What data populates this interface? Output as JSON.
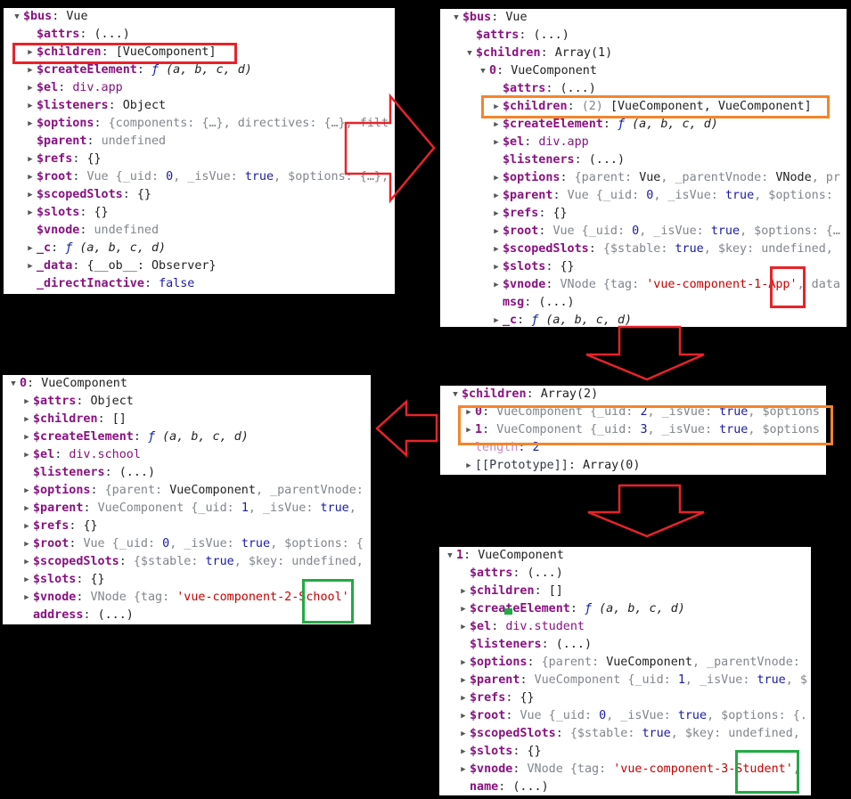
{
  "colors": {
    "arrow": "#e8222a",
    "red_box": "#e8222a",
    "orange_box": "#f5842a",
    "green_box": "#22aa44"
  },
  "panels": [
    {
      "id": "bus-root",
      "rows": [
        {
          "level": 0,
          "arrow": "expanded",
          "key": "$bus",
          "value": [
            [
              "t",
              "Vue"
            ]
          ]
        },
        {
          "level": 1,
          "arrow": "none",
          "key": "$attrs",
          "value": [
            [
              "t",
              "(...)"
            ]
          ]
        },
        {
          "level": 1,
          "arrow": "collapsed",
          "key": "$children",
          "value": [
            [
              "t",
              "[VueComponent]"
            ]
          ]
        },
        {
          "level": 1,
          "arrow": "collapsed",
          "key": "$createElement",
          "value": [
            [
              "f",
              "ƒ "
            ],
            [
              "i",
              "(a, b, c, d)"
            ]
          ]
        },
        {
          "level": 1,
          "arrow": "collapsed",
          "key": "$el",
          "value": [
            [
              "e",
              "div.app"
            ]
          ]
        },
        {
          "level": 1,
          "arrow": "collapsed",
          "key": "$listeners",
          "value": [
            [
              "t",
              "Object"
            ]
          ]
        },
        {
          "level": 1,
          "arrow": "collapsed",
          "key": "$options",
          "value": [
            [
              "g",
              "{components: {…}, directives: {…}, filt"
            ]
          ]
        },
        {
          "level": 1,
          "arrow": "none",
          "key": "$parent",
          "value": [
            [
              "g",
              "undefined"
            ]
          ]
        },
        {
          "level": 1,
          "arrow": "collapsed",
          "key": "$refs",
          "value": [
            [
              "t",
              "{}"
            ]
          ]
        },
        {
          "level": 1,
          "arrow": "collapsed",
          "key": "$root",
          "value": [
            [
              "g",
              "Vue {_uid: "
            ],
            [
              "n",
              "0"
            ],
            [
              "g",
              ", _isVue: "
            ],
            [
              "n",
              "true"
            ],
            [
              "g",
              ", $options: {…},"
            ]
          ]
        },
        {
          "level": 1,
          "arrow": "collapsed",
          "key": "$scopedSlots",
          "value": [
            [
              "t",
              "{}"
            ]
          ]
        },
        {
          "level": 1,
          "arrow": "collapsed",
          "key": "$slots",
          "value": [
            [
              "t",
              "{}"
            ]
          ]
        },
        {
          "level": 1,
          "arrow": "none",
          "key": "$vnode",
          "value": [
            [
              "g",
              "undefined"
            ]
          ]
        },
        {
          "level": 1,
          "arrow": "collapsed",
          "key": "_c",
          "value": [
            [
              "f",
              "ƒ "
            ],
            [
              "i",
              "(a, b, c, d)"
            ]
          ]
        },
        {
          "level": 1,
          "arrow": "collapsed",
          "key": "_data",
          "value": [
            [
              "t",
              "{__ob__: Observer}"
            ]
          ]
        },
        {
          "level": 1,
          "arrow": "none",
          "key": "_directInactive",
          "value": [
            [
              "n",
              "false"
            ]
          ]
        }
      ]
    },
    {
      "id": "bus-children-expanded",
      "rows": [
        {
          "level": 0,
          "arrow": "expanded",
          "key": "$bus",
          "value": [
            [
              "t",
              "Vue"
            ]
          ]
        },
        {
          "level": 1,
          "arrow": "none",
          "key": "$attrs",
          "value": [
            [
              "t",
              "(...)"
            ]
          ]
        },
        {
          "level": 1,
          "arrow": "expanded",
          "key": "$children",
          "value": [
            [
              "t",
              "Array(1)"
            ]
          ]
        },
        {
          "level": 2,
          "arrow": "expanded",
          "key": "0",
          "value": [
            [
              "t",
              "VueComponent"
            ]
          ]
        },
        {
          "level": 3,
          "arrow": "none",
          "key": "$attrs",
          "value": [
            [
              "t",
              "(...)"
            ]
          ]
        },
        {
          "level": 3,
          "arrow": "collapsed",
          "key": "$children",
          "value": [
            [
              "g",
              "(2) "
            ],
            [
              "t",
              "[VueComponent, VueComponent]"
            ]
          ]
        },
        {
          "level": 3,
          "arrow": "collapsed",
          "key": "$createElement",
          "value": [
            [
              "f",
              "ƒ "
            ],
            [
              "i",
              "(a, b, c, d)"
            ]
          ]
        },
        {
          "level": 3,
          "arrow": "collapsed",
          "key": "$el",
          "value": [
            [
              "e",
              "div.app"
            ]
          ]
        },
        {
          "level": 3,
          "arrow": "none",
          "key": "$listeners",
          "value": [
            [
              "t",
              "(...)"
            ]
          ]
        },
        {
          "level": 3,
          "arrow": "collapsed",
          "key": "$options",
          "value": [
            [
              "g",
              "{parent: "
            ],
            [
              "t",
              "Vue"
            ],
            [
              "g",
              ", _parentVnode: "
            ],
            [
              "t",
              "VNode"
            ],
            [
              "g",
              ", pr"
            ]
          ]
        },
        {
          "level": 3,
          "arrow": "collapsed",
          "key": "$parent",
          "value": [
            [
              "g",
              "Vue {_uid: "
            ],
            [
              "n",
              "0"
            ],
            [
              "g",
              ", _isVue: "
            ],
            [
              "n",
              "true"
            ],
            [
              "g",
              ", $options:"
            ]
          ]
        },
        {
          "level": 3,
          "arrow": "collapsed",
          "key": "$refs",
          "value": [
            [
              "t",
              "{}"
            ]
          ]
        },
        {
          "level": 3,
          "arrow": "collapsed",
          "key": "$root",
          "value": [
            [
              "g",
              "Vue {_uid: "
            ],
            [
              "n",
              "0"
            ],
            [
              "g",
              ", _isVue: "
            ],
            [
              "n",
              "true"
            ],
            [
              "g",
              ", $options: {…"
            ]
          ]
        },
        {
          "level": 3,
          "arrow": "collapsed",
          "key": "$scopedSlots",
          "value": [
            [
              "g",
              "{$stable: "
            ],
            [
              "n",
              "true"
            ],
            [
              "g",
              ", $key: undefined,"
            ]
          ]
        },
        {
          "level": 3,
          "arrow": "collapsed",
          "key": "$slots",
          "value": [
            [
              "t",
              "{}"
            ]
          ]
        },
        {
          "level": 3,
          "arrow": "collapsed",
          "key": "$vnode",
          "value": [
            [
              "g",
              "VNode {tag: "
            ],
            [
              "s",
              "'vue-component-1-App'"
            ],
            [
              "g",
              ", data"
            ]
          ]
        },
        {
          "level": 3,
          "arrow": "none",
          "key": "msg",
          "value": [
            [
              "t",
              "(...)"
            ]
          ]
        },
        {
          "level": 3,
          "arrow": "collapsed",
          "key": "_c",
          "value": [
            [
              "f",
              "ƒ "
            ],
            [
              "i",
              "(a, b, c, d)"
            ]
          ]
        }
      ]
    },
    {
      "id": "school-component",
      "rows": [
        {
          "level": 0,
          "arrow": "expanded",
          "key": "0",
          "value": [
            [
              "t",
              "VueComponent"
            ]
          ]
        },
        {
          "level": 1,
          "arrow": "collapsed",
          "key": "$attrs",
          "value": [
            [
              "t",
              "Object"
            ]
          ]
        },
        {
          "level": 1,
          "arrow": "collapsed",
          "key": "$children",
          "value": [
            [
              "t",
              "[]"
            ]
          ]
        },
        {
          "level": 1,
          "arrow": "collapsed",
          "key": "$createElement",
          "value": [
            [
              "f",
              "ƒ "
            ],
            [
              "i",
              "(a, b, c, d)"
            ]
          ]
        },
        {
          "level": 1,
          "arrow": "collapsed",
          "key": "$el",
          "value": [
            [
              "e",
              "div.school"
            ]
          ]
        },
        {
          "level": 1,
          "arrow": "none",
          "key": "$listeners",
          "value": [
            [
              "t",
              "(...)"
            ]
          ]
        },
        {
          "level": 1,
          "arrow": "collapsed",
          "key": "$options",
          "value": [
            [
              "g",
              "{parent: "
            ],
            [
              "t",
              "VueComponent"
            ],
            [
              "g",
              ", _parentVnode:"
            ]
          ]
        },
        {
          "level": 1,
          "arrow": "collapsed",
          "key": "$parent",
          "value": [
            [
              "g",
              "VueComponent {_uid: "
            ],
            [
              "n",
              "1"
            ],
            [
              "g",
              ", _isVue: "
            ],
            [
              "n",
              "true"
            ],
            [
              "g",
              ","
            ]
          ]
        },
        {
          "level": 1,
          "arrow": "collapsed",
          "key": "$refs",
          "value": [
            [
              "t",
              "{}"
            ]
          ]
        },
        {
          "level": 1,
          "arrow": "collapsed",
          "key": "$root",
          "value": [
            [
              "g",
              "Vue {_uid: "
            ],
            [
              "n",
              "0"
            ],
            [
              "g",
              ", _isVue: "
            ],
            [
              "n",
              "true"
            ],
            [
              "g",
              ", $options: {"
            ]
          ]
        },
        {
          "level": 1,
          "arrow": "collapsed",
          "key": "$scopedSlots",
          "value": [
            [
              "g",
              "{$stable: "
            ],
            [
              "n",
              "true"
            ],
            [
              "g",
              ", $key: undefined,"
            ]
          ]
        },
        {
          "level": 1,
          "arrow": "collapsed",
          "key": "$slots",
          "value": [
            [
              "t",
              "{}"
            ]
          ]
        },
        {
          "level": 1,
          "arrow": "collapsed",
          "key": "$vnode",
          "value": [
            [
              "g",
              "VNode {tag: "
            ],
            [
              "s",
              "'vue-component-2-School'"
            ],
            [
              "g",
              ","
            ]
          ]
        },
        {
          "level": 1,
          "arrow": "none",
          "key": "address",
          "value": [
            [
              "t",
              "(...)"
            ]
          ]
        }
      ]
    },
    {
      "id": "app-children-array",
      "rows": [
        {
          "level": 0,
          "arrow": "expanded",
          "key": "$children",
          "value": [
            [
              "t",
              "Array(2)"
            ]
          ]
        },
        {
          "level": 1,
          "arrow": "collapsed",
          "key": "0",
          "value": [
            [
              "g",
              "VueComponent {_uid: "
            ],
            [
              "n",
              "2"
            ],
            [
              "g",
              ", _isVue: "
            ],
            [
              "n",
              "true"
            ],
            [
              "g",
              ", $options"
            ]
          ]
        },
        {
          "level": 1,
          "arrow": "collapsed",
          "key": "1",
          "value": [
            [
              "g",
              "VueComponent {_uid: "
            ],
            [
              "n",
              "3"
            ],
            [
              "g",
              ", _isVue: "
            ],
            [
              "n",
              "true"
            ],
            [
              "g",
              ", $options"
            ]
          ]
        },
        {
          "level": 1,
          "arrow": "none",
          "key": "length",
          "key_style": "light",
          "value": [
            [
              "n",
              "2"
            ]
          ]
        },
        {
          "level": 1,
          "arrow": "collapsed",
          "key": "[[Prototype]]",
          "key_style": "plain",
          "value": [
            [
              "t",
              "Array(0)"
            ]
          ]
        }
      ]
    },
    {
      "id": "student-component",
      "rows": [
        {
          "level": 0,
          "arrow": "expanded",
          "key": "1",
          "value": [
            [
              "t",
              "VueComponent"
            ]
          ]
        },
        {
          "level": 1,
          "arrow": "none",
          "key": "$attrs",
          "value": [
            [
              "t",
              "(...)"
            ]
          ]
        },
        {
          "level": 1,
          "arrow": "collapsed",
          "key": "$children",
          "value": [
            [
              "t",
              "[]"
            ]
          ]
        },
        {
          "level": 1,
          "arrow": "collapsed",
          "key": "$createElement",
          "value": [
            [
              "f",
              "ƒ "
            ],
            [
              "i",
              "(a, b, c, d)"
            ]
          ]
        },
        {
          "level": 1,
          "arrow": "collapsed",
          "key": "$el",
          "value": [
            [
              "e",
              "div.student"
            ]
          ]
        },
        {
          "level": 1,
          "arrow": "none",
          "key": "$listeners",
          "value": [
            [
              "t",
              "(...)"
            ]
          ]
        },
        {
          "level": 1,
          "arrow": "collapsed",
          "key": "$options",
          "value": [
            [
              "g",
              "{parent: "
            ],
            [
              "t",
              "VueComponent"
            ],
            [
              "g",
              ", _parentVnode:"
            ]
          ]
        },
        {
          "level": 1,
          "arrow": "collapsed",
          "key": "$parent",
          "value": [
            [
              "g",
              "VueComponent {_uid: "
            ],
            [
              "n",
              "1"
            ],
            [
              "g",
              ", _isVue: "
            ],
            [
              "n",
              "true"
            ],
            [
              "g",
              ", $"
            ]
          ]
        },
        {
          "level": 1,
          "arrow": "collapsed",
          "key": "$refs",
          "value": [
            [
              "t",
              "{}"
            ]
          ]
        },
        {
          "level": 1,
          "arrow": "collapsed",
          "key": "$root",
          "value": [
            [
              "g",
              "Vue {_uid: "
            ],
            [
              "n",
              "0"
            ],
            [
              "g",
              ", _isVue: "
            ],
            [
              "n",
              "true"
            ],
            [
              "g",
              ", $options: {."
            ]
          ]
        },
        {
          "level": 1,
          "arrow": "collapsed",
          "key": "$scopedSlots",
          "value": [
            [
              "g",
              "{$stable: "
            ],
            [
              "n",
              "true"
            ],
            [
              "g",
              ", $key: undefined,"
            ]
          ]
        },
        {
          "level": 1,
          "arrow": "collapsed",
          "key": "$slots",
          "value": [
            [
              "t",
              "{}"
            ]
          ]
        },
        {
          "level": 1,
          "arrow": "collapsed",
          "key": "$vnode",
          "value": [
            [
              "g",
              "VNode {tag: "
            ],
            [
              "s",
              "'vue-component-3-Student'"
            ],
            [
              "g",
              ","
            ]
          ]
        },
        {
          "level": 1,
          "arrow": "none",
          "key": "name",
          "value": [
            [
              "t",
              "(...)"
            ]
          ]
        }
      ]
    }
  ]
}
